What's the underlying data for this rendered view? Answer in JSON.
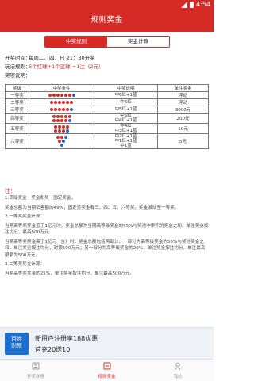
{
  "status": {
    "time": "4:54"
  },
  "header": {
    "title": "规则奖金"
  },
  "tabs": [
    {
      "label": "中奖规则",
      "active": true
    },
    {
      "label": "奖金计算",
      "active": false
    }
  ],
  "info": {
    "open_label": "开奖时间：",
    "open_value": "每周二、四、日 21：30开奖",
    "play_label": "玩法规则：",
    "play_value": "6个红球+1个蓝球 =1注（2元）",
    "desc_label": "奖项说明："
  },
  "table": {
    "headers": [
      "奖级",
      "中奖条件",
      "中奖说明",
      "单注奖金"
    ],
    "rows": [
      {
        "level": "一等奖",
        "balls": [
          [
            6,
            1
          ]
        ],
        "desc": [
          "中6红+1蓝"
        ],
        "prize": "浮动"
      },
      {
        "level": "二等奖",
        "balls": [
          [
            6,
            0
          ]
        ],
        "desc": [
          "中6红"
        ],
        "prize": "浮动"
      },
      {
        "level": "三等奖",
        "balls": [
          [
            5,
            1
          ]
        ],
        "desc": [
          "中5红+1蓝"
        ],
        "prize": "3000元"
      },
      {
        "level": "四等奖",
        "balls": [
          [
            5,
            0
          ],
          [
            4,
            1
          ]
        ],
        "desc": [
          "中5红",
          "中4红+1蓝"
        ],
        "prize": "200元"
      },
      {
        "level": "五等奖",
        "balls": [
          [
            4,
            0
          ],
          [
            3,
            1
          ]
        ],
        "desc": [
          "中4红",
          "中3红+1蓝"
        ],
        "prize": "10元"
      },
      {
        "level": "六等奖",
        "balls": [
          [
            2,
            1
          ],
          [
            1,
            1
          ],
          [
            0,
            1
          ]
        ],
        "desc": [
          "中2红+1蓝",
          "中1红+1蓝",
          "中1蓝"
        ],
        "prize": "5元"
      }
    ]
  },
  "notes": {
    "heading": "注：",
    "items": [
      "1.高级奖金 - 奖金和奖 - 固定奖金。",
      "奖金总额为当期销售额的49%，固定奖奖金有三、四、五、六等奖。奖金滚动至一等奖。",
      "2.一等奖奖金计算：",
      "当期高等奖奖金低于1亿元时，奖金总额为当期高等级奖金的75%与奖池中累积的奖金之和，单注奖金按注均分，最高500万元。",
      "当期高等奖奖金高于1亿元（含）时，奖金总额包括两部分，一部分为高等级奖金的55%与奖池奖金之和，单注奖金按注均分，封顶500万元；另一部分为高等级奖金的20%，单注奖金按注均分，单注最高限额为500万元。",
      "3.二等奖奖金计算：",
      "当期高等奖奖金的25%，单注奖金按注均分，单注最高500万元。"
    ]
  },
  "banner": {
    "logo_line1": "百姓",
    "logo_line2": "彩票",
    "line1": "新用户注册享188优惠",
    "line2": "首充20送10"
  },
  "tabbar": [
    {
      "label": "开奖详情",
      "active": false
    },
    {
      "label": "规则奖金",
      "active": true
    },
    {
      "label": "我的",
      "active": false
    }
  ],
  "colors": {
    "brand": "#d52a26",
    "blue_ball": "#2d63c8"
  }
}
